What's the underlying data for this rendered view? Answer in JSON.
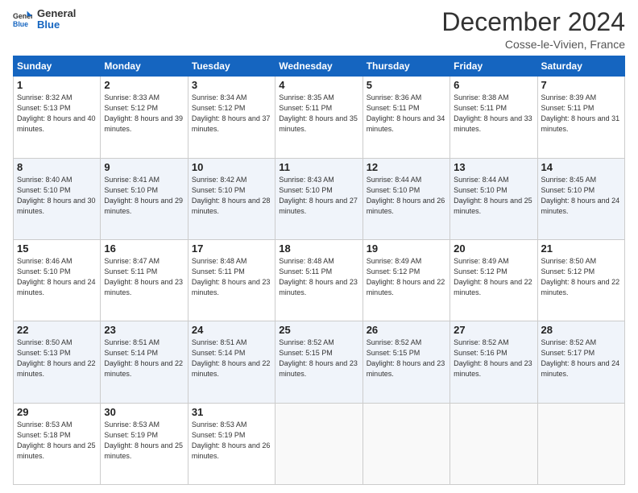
{
  "header": {
    "logo_line1": "General",
    "logo_line2": "Blue",
    "month_title": "December 2024",
    "location": "Cosse-le-Vivien, France"
  },
  "days_of_week": [
    "Sunday",
    "Monday",
    "Tuesday",
    "Wednesday",
    "Thursday",
    "Friday",
    "Saturday"
  ],
  "weeks": [
    [
      {
        "day": "1",
        "sunrise": "8:32 AM",
        "sunset": "5:13 PM",
        "daylight": "8 hours and 40 minutes."
      },
      {
        "day": "2",
        "sunrise": "8:33 AM",
        "sunset": "5:12 PM",
        "daylight": "8 hours and 39 minutes."
      },
      {
        "day": "3",
        "sunrise": "8:34 AM",
        "sunset": "5:12 PM",
        "daylight": "8 hours and 37 minutes."
      },
      {
        "day": "4",
        "sunrise": "8:35 AM",
        "sunset": "5:11 PM",
        "daylight": "8 hours and 35 minutes."
      },
      {
        "day": "5",
        "sunrise": "8:36 AM",
        "sunset": "5:11 PM",
        "daylight": "8 hours and 34 minutes."
      },
      {
        "day": "6",
        "sunrise": "8:38 AM",
        "sunset": "5:11 PM",
        "daylight": "8 hours and 33 minutes."
      },
      {
        "day": "7",
        "sunrise": "8:39 AM",
        "sunset": "5:11 PM",
        "daylight": "8 hours and 31 minutes."
      }
    ],
    [
      {
        "day": "8",
        "sunrise": "8:40 AM",
        "sunset": "5:10 PM",
        "daylight": "8 hours and 30 minutes."
      },
      {
        "day": "9",
        "sunrise": "8:41 AM",
        "sunset": "5:10 PM",
        "daylight": "8 hours and 29 minutes."
      },
      {
        "day": "10",
        "sunrise": "8:42 AM",
        "sunset": "5:10 PM",
        "daylight": "8 hours and 28 minutes."
      },
      {
        "day": "11",
        "sunrise": "8:43 AM",
        "sunset": "5:10 PM",
        "daylight": "8 hours and 27 minutes."
      },
      {
        "day": "12",
        "sunrise": "8:44 AM",
        "sunset": "5:10 PM",
        "daylight": "8 hours and 26 minutes."
      },
      {
        "day": "13",
        "sunrise": "8:44 AM",
        "sunset": "5:10 PM",
        "daylight": "8 hours and 25 minutes."
      },
      {
        "day": "14",
        "sunrise": "8:45 AM",
        "sunset": "5:10 PM",
        "daylight": "8 hours and 24 minutes."
      }
    ],
    [
      {
        "day": "15",
        "sunrise": "8:46 AM",
        "sunset": "5:10 PM",
        "daylight": "8 hours and 24 minutes."
      },
      {
        "day": "16",
        "sunrise": "8:47 AM",
        "sunset": "5:11 PM",
        "daylight": "8 hours and 23 minutes."
      },
      {
        "day": "17",
        "sunrise": "8:48 AM",
        "sunset": "5:11 PM",
        "daylight": "8 hours and 23 minutes."
      },
      {
        "day": "18",
        "sunrise": "8:48 AM",
        "sunset": "5:11 PM",
        "daylight": "8 hours and 23 minutes."
      },
      {
        "day": "19",
        "sunrise": "8:49 AM",
        "sunset": "5:12 PM",
        "daylight": "8 hours and 22 minutes."
      },
      {
        "day": "20",
        "sunrise": "8:49 AM",
        "sunset": "5:12 PM",
        "daylight": "8 hours and 22 minutes."
      },
      {
        "day": "21",
        "sunrise": "8:50 AM",
        "sunset": "5:12 PM",
        "daylight": "8 hours and 22 minutes."
      }
    ],
    [
      {
        "day": "22",
        "sunrise": "8:50 AM",
        "sunset": "5:13 PM",
        "daylight": "8 hours and 22 minutes."
      },
      {
        "day": "23",
        "sunrise": "8:51 AM",
        "sunset": "5:14 PM",
        "daylight": "8 hours and 22 minutes."
      },
      {
        "day": "24",
        "sunrise": "8:51 AM",
        "sunset": "5:14 PM",
        "daylight": "8 hours and 22 minutes."
      },
      {
        "day": "25",
        "sunrise": "8:52 AM",
        "sunset": "5:15 PM",
        "daylight": "8 hours and 23 minutes."
      },
      {
        "day": "26",
        "sunrise": "8:52 AM",
        "sunset": "5:15 PM",
        "daylight": "8 hours and 23 minutes."
      },
      {
        "day": "27",
        "sunrise": "8:52 AM",
        "sunset": "5:16 PM",
        "daylight": "8 hours and 23 minutes."
      },
      {
        "day": "28",
        "sunrise": "8:52 AM",
        "sunset": "5:17 PM",
        "daylight": "8 hours and 24 minutes."
      }
    ],
    [
      {
        "day": "29",
        "sunrise": "8:53 AM",
        "sunset": "5:18 PM",
        "daylight": "8 hours and 25 minutes."
      },
      {
        "day": "30",
        "sunrise": "8:53 AM",
        "sunset": "5:19 PM",
        "daylight": "8 hours and 25 minutes."
      },
      {
        "day": "31",
        "sunrise": "8:53 AM",
        "sunset": "5:19 PM",
        "daylight": "8 hours and 26 minutes."
      },
      null,
      null,
      null,
      null
    ]
  ]
}
